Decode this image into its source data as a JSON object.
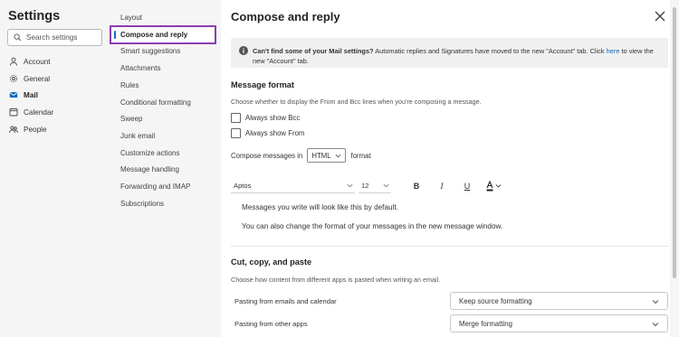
{
  "nav": {
    "title": "Settings",
    "search_placeholder": "Search settings",
    "categories": [
      {
        "label": "Account",
        "icon": "person-icon"
      },
      {
        "label": "General",
        "icon": "gear-icon"
      },
      {
        "label": "Mail",
        "icon": "mail-icon",
        "active": true
      },
      {
        "label": "Calendar",
        "icon": "calendar-icon"
      },
      {
        "label": "People",
        "icon": "people-icon"
      }
    ]
  },
  "subnav": {
    "items": [
      "Layout",
      "Compose and reply",
      "Smart suggestions",
      "Attachments",
      "Rules",
      "Conditional formatting",
      "Sweep",
      "Junk email",
      "Customize actions",
      "Message handling",
      "Forwarding and IMAP",
      "Subscriptions"
    ],
    "selected": "Compose and reply",
    "highlight_color": "#8a3eb0"
  },
  "panel": {
    "title": "Compose and reply",
    "info": {
      "bold": "Can't find some of your Mail settings?",
      "text": " Automatic replies and Signatures have moved to the new \"Account\" tab. Click ",
      "link": "here",
      "text_after": " to view the new \"Account\" tab."
    },
    "message_format": {
      "heading": "Message format",
      "description": "Choose whether to display the From and Bcc lines when you're composing a message.",
      "always_show_bcc": "Always show Bcc",
      "always_show_from": "Always show From",
      "compose_prefix": "Compose messages in",
      "compose_format": "HTML",
      "compose_suffix": "format",
      "font": "Aptos",
      "size": "12",
      "bold_glyph": "B",
      "italic_glyph": "I",
      "underline_glyph": "U",
      "preview_line1": "Messages you write will look like this by default.",
      "preview_line2": "You can also change the format of your messages in the new message window."
    },
    "cut_copy_paste": {
      "heading": "Cut, copy, and paste",
      "description": "Choose how content from different apps is pasted when writing an email.",
      "rows": [
        {
          "label": "Pasting from emails and calendar",
          "value": "Keep source formatting"
        },
        {
          "label": "Pasting from other apps",
          "value": "Merge formatting"
        }
      ]
    }
  },
  "colors": {
    "accent": "#0f6cbd",
    "selection_outline": "#8a3eb0"
  }
}
